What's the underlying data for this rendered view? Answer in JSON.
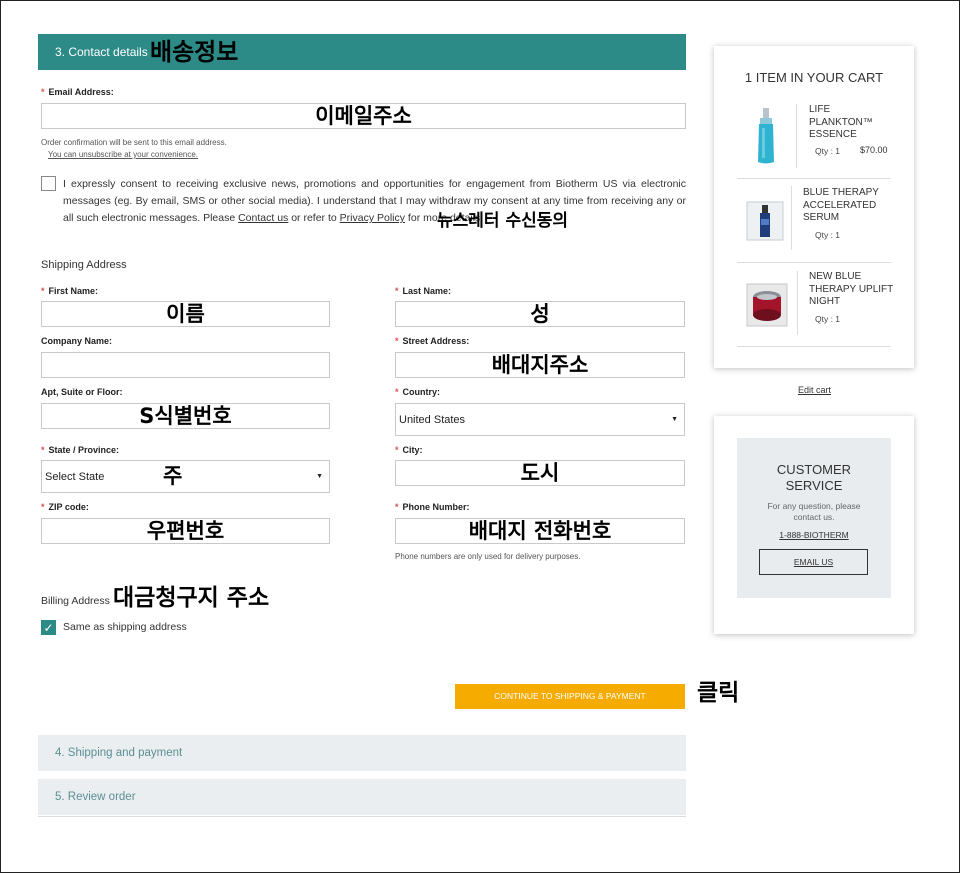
{
  "sections": {
    "contact": "3. Contact details",
    "shipping_payment": "4. Shipping and payment",
    "review": "5. Review order"
  },
  "annotations": {
    "shipping_info": "배송정보",
    "email": "이메일주소",
    "newsletter": "뉴스레터 수신동의",
    "first_name": "이름",
    "last_name": "성",
    "street": "배대지주소",
    "suite": "S식별번호",
    "state": "주",
    "city": "도시",
    "zip": "우편번호",
    "phone": "배대지 전화번호",
    "billing": "대금청구지 주소",
    "click": "클릭"
  },
  "contact": {
    "email_label": "Email Address:",
    "email_note": "Order confirmation will be sent to this email address.",
    "unsubscribe": "You can unsubscribe at your convenience.",
    "consent_text_1": "I expressly consent to receiving exclusive news, promotions and opportunities for engagement from Biotherm US via electronic messages (eg. By email, SMS or other social media). I understand that I may withdraw my consent at any time from receiving any or all such electronic messages. Please ",
    "contact_us": "Contact us",
    "consent_text_2": " or refer to ",
    "privacy_policy": "Privacy Policy",
    "consent_text_3": " for more details."
  },
  "shipping": {
    "heading": "Shipping Address",
    "first_name_label": "First Name:",
    "last_name_label": "Last Name:",
    "company_label": "Company Name:",
    "street_label": "Street Address:",
    "apt_label": "Apt, Suite or Floor:",
    "country_label": "Country:",
    "country_value": "United States",
    "state_label": "State / Province:",
    "state_value": "Select State",
    "city_label": "City:",
    "zip_label": "ZIP code:",
    "phone_label": "Phone Number:",
    "phone_note": "Phone numbers are only used for delivery purposes."
  },
  "billing": {
    "heading": "Billing Address",
    "same_as_shipping": "Same as shipping address"
  },
  "cta": "CONTINUE TO SHIPPING & PAYMENT",
  "cart": {
    "title": "1 ITEM IN YOUR CART",
    "items": [
      {
        "name": "LIFE PLANKTON™ ESSENCE",
        "qty": "Qty : 1",
        "price": "$70.00"
      },
      {
        "name": "BLUE THERAPY ACCELERATED SERUM",
        "qty": "Qty : 1",
        "price": ""
      },
      {
        "name": "NEW BLUE THERAPY UPLIFT NIGHT",
        "qty": "Qty : 1",
        "price": ""
      }
    ],
    "edit_cart": "Edit cart"
  },
  "service": {
    "title": "CUSTOMER SERVICE",
    "subtitle": "For any question, please contact us.",
    "phone": "1-888-BIOTHERM",
    "email_button": "EMAIL US"
  },
  "colors": {
    "accent": "#2c8a87",
    "cta": "#f5ab00",
    "section_inactive": "#eaeef0"
  }
}
